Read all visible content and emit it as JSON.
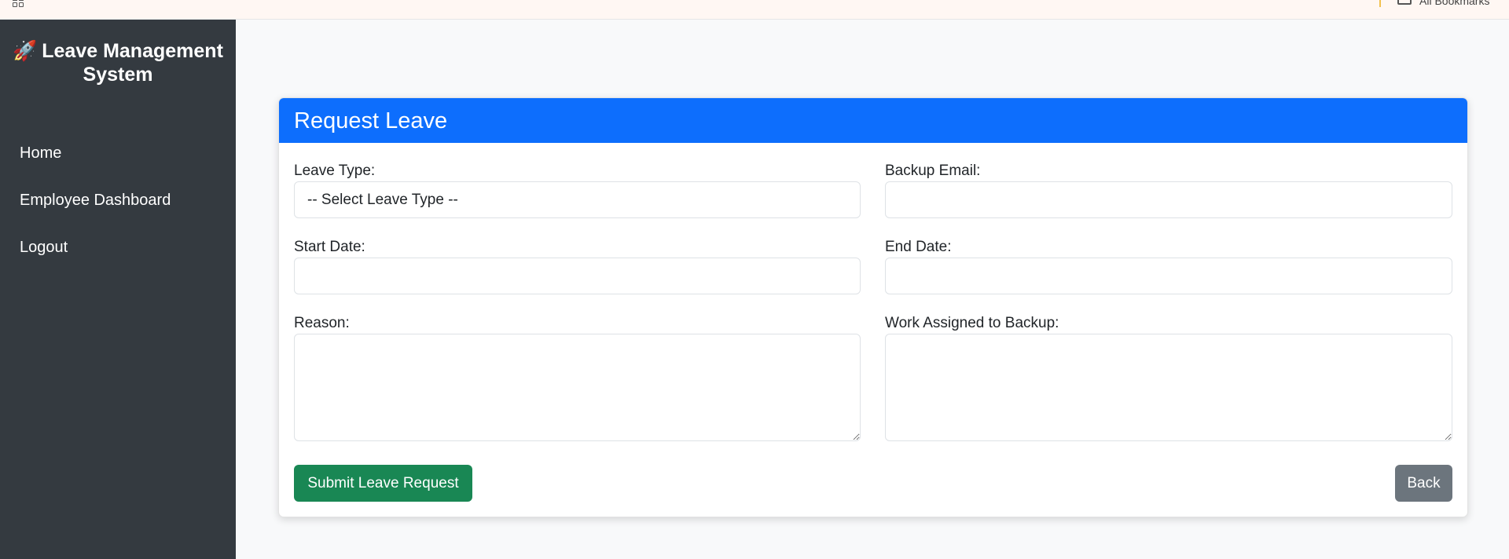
{
  "browser": {
    "bookmarks_label": "All Bookmarks"
  },
  "sidebar": {
    "brand_icon": "🚀",
    "brand_title": "Leave Management System",
    "items": [
      {
        "label": "Home"
      },
      {
        "label": "Employee Dashboard"
      },
      {
        "label": "Logout"
      }
    ]
  },
  "form": {
    "title": "Request Leave",
    "leave_type_label": "Leave Type:",
    "leave_type_selected": "-- Select Leave Type --",
    "backup_email_label": "Backup Email:",
    "backup_email_value": "",
    "start_date_label": "Start Date:",
    "start_date_value": "",
    "end_date_label": "End Date:",
    "end_date_value": "",
    "reason_label": "Reason:",
    "reason_value": "",
    "work_assigned_label": "Work Assigned to Backup:",
    "work_assigned_value": "",
    "submit_label": "Submit Leave Request",
    "back_label": "Back"
  },
  "colors": {
    "sidebar_bg": "#343a40",
    "header_bg": "#0d6efd",
    "submit_bg": "#198754",
    "back_bg": "#6c757d"
  }
}
